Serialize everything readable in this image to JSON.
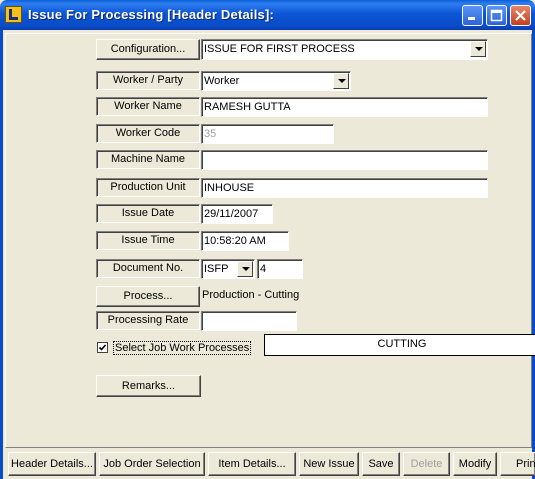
{
  "window": {
    "title": "Issue For Processing [Header Details]:",
    "controls": [
      "minimize-icon",
      "maximize-icon",
      "close-icon"
    ]
  },
  "form": {
    "configuration": {
      "button": "Configuration...",
      "value": "ISSUE FOR FIRST PROCESS"
    },
    "worker_party": {
      "label": "Worker / Party",
      "value": "Worker"
    },
    "worker_name": {
      "label": "Worker Name",
      "value": "RAMESH GUTTA"
    },
    "worker_code": {
      "label": "Worker Code",
      "value": "35"
    },
    "machine_name": {
      "label": "Machine Name",
      "value": ""
    },
    "production_unit": {
      "label": "Production Unit",
      "value": "INHOUSE"
    },
    "issue_date": {
      "label": "Issue Date",
      "value": "29/11/2007"
    },
    "issue_time": {
      "label": "Issue Time",
      "value": "10:58:20 AM"
    },
    "document_no": {
      "label": "Document No.",
      "prefix": "ISFP",
      "number": "4"
    },
    "process": {
      "button": "Process...",
      "value": "Production - Cutting"
    },
    "processing_rate": {
      "label": "Processing Rate",
      "value": ""
    },
    "job_work": {
      "label": "Select Job Work Processes",
      "checked": true,
      "selected": "CUTTING"
    },
    "remarks": {
      "button": "Remarks..."
    }
  },
  "toolbar": {
    "header_details": "Header Details...",
    "job_order_selection": "Job Order Selection",
    "item_details": "Item Details...",
    "new_issue": "New Issue",
    "save": "Save",
    "delete": "Delete",
    "modify": "Modify",
    "print": "Prin"
  }
}
